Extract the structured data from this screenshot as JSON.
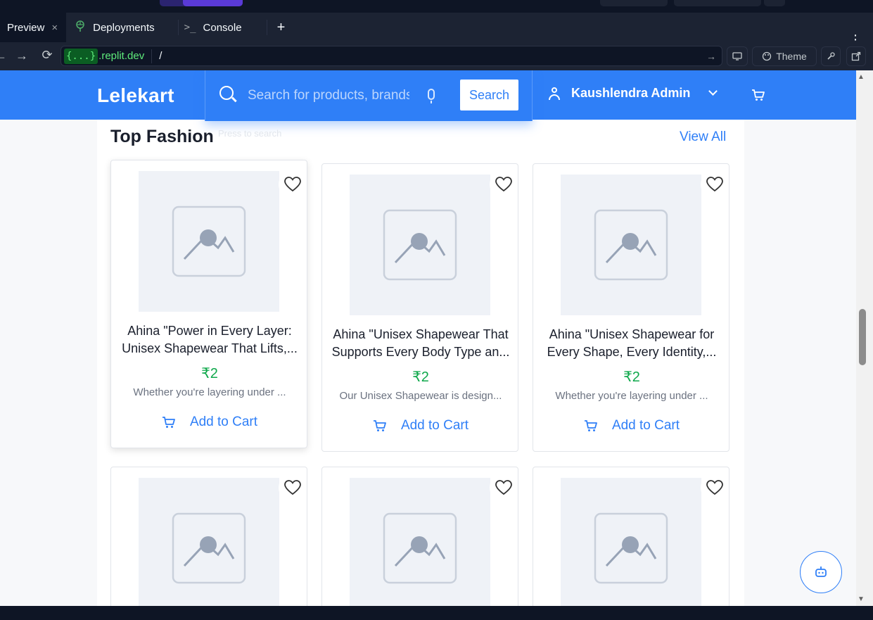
{
  "ide": {
    "tabs": [
      {
        "label": "Preview",
        "close": "×"
      },
      {
        "label": "Deployments"
      },
      {
        "label": "Console",
        "icon": ">_"
      }
    ],
    "add_tab": "+",
    "more": "⋮",
    "url": {
      "badge": "{...}",
      "domain": ".replit.dev",
      "path": "/"
    },
    "theme_label": "Theme"
  },
  "site": {
    "brand": "Lelekart",
    "search_placeholder": "Search for products, brands and more",
    "search_button": "Search",
    "user_name": "Kaushlendra Admin",
    "faint_text": "Press to search",
    "section_title": "Top Fashion",
    "view_all": "View All",
    "products": [
      {
        "title": "Ahina \"Power in Every Layer: Unisex Shapewear That Lifts,...",
        "price": "₹2",
        "desc": "Whether you're layering under ...",
        "cta": "Add to Cart"
      },
      {
        "title": "Ahina \"Unisex Shapewear That Supports Every Body Type an...",
        "price": "₹2",
        "desc": "Our Unisex Shapewear is design...",
        "cta": "Add to Cart"
      },
      {
        "title": "Ahina \"Unisex Shapewear for Every Shape, Every Identity,...",
        "price": "₹2",
        "desc": "Whether you're layering under ...",
        "cta": "Add to Cart"
      },
      {
        "title": "",
        "price": "",
        "desc": "",
        "cta": ""
      },
      {
        "title": "",
        "price": "",
        "desc": "",
        "cta": ""
      },
      {
        "title": "",
        "price": "",
        "desc": "",
        "cta": ""
      }
    ]
  },
  "colors": {
    "brand_blue": "#2f7ff7",
    "price_green": "#0fa84b",
    "ide_bg": "#1c2333"
  }
}
